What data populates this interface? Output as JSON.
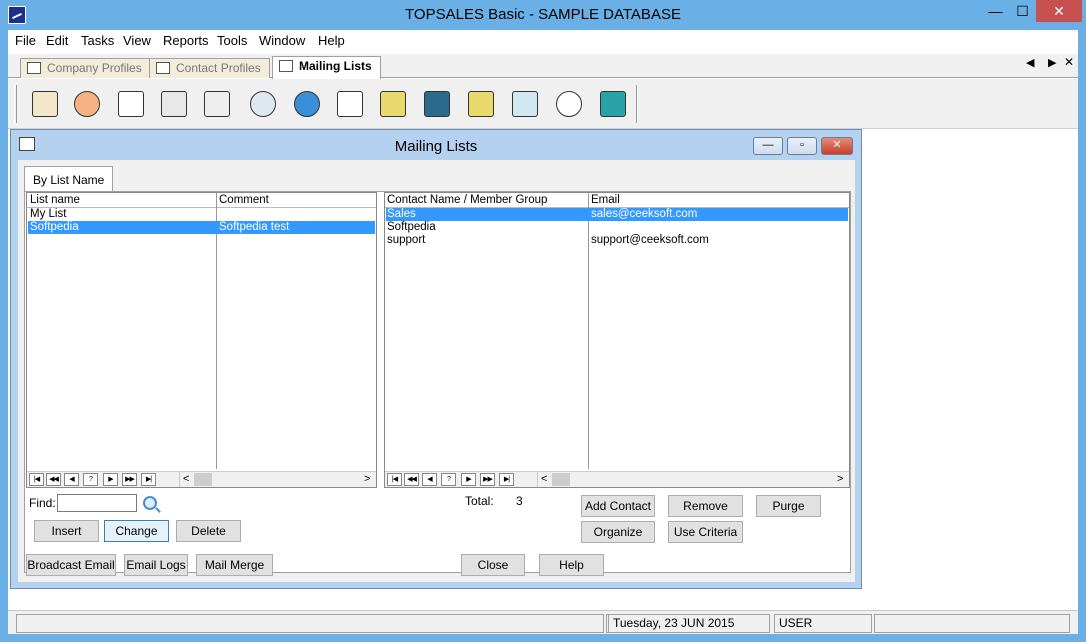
{
  "app": {
    "title": "TOPSALES Basic - SAMPLE DATABASE",
    "min_glyph": "—",
    "max_glyph": "☐",
    "close_glyph": "✕"
  },
  "menu": [
    "File",
    "Edit",
    "Tasks",
    "View",
    "Reports",
    "Tools",
    "Window",
    "Help"
  ],
  "doc_tabs": [
    {
      "label": "Company Profiles",
      "active": false
    },
    {
      "label": "Contact Profiles",
      "active": false
    },
    {
      "label": "Mailing Lists",
      "active": true
    }
  ],
  "doc_nav": {
    "prev": "◀",
    "next": "▶",
    "close": "✕"
  },
  "toolbar_icons": [
    "contact-home-icon",
    "people-icon",
    "envelope-icon",
    "address-card-icon",
    "calendar-icon",
    "magnifier-report-icon",
    "globe-computer-icon",
    "dollar-document-icon",
    "cash-register-icon",
    "bank-icon",
    "warehouse-icon",
    "desk-lamp-icon",
    "stopwatch-icon",
    "calculator-icon"
  ],
  "mdi": {
    "title": "Mailing Lists",
    "min_glyph": "—",
    "max_glyph": "▫",
    "close_glyph": "✕",
    "tab_label": "By List Name"
  },
  "lists_grid": {
    "columns": [
      "List name",
      "Comment"
    ],
    "rows": [
      {
        "name": "My List",
        "comment": "",
        "selected": false
      },
      {
        "name": "Softpedia",
        "comment": "Softpedia test",
        "selected": true
      }
    ]
  },
  "members_grid": {
    "columns": [
      "Contact Name / Member Group",
      "Email"
    ],
    "rows": [
      {
        "name": "Sales",
        "email": "sales@ceeksoft.com",
        "selected": true
      },
      {
        "name": "Softpedia",
        "email": "",
        "selected": false
      },
      {
        "name": "support",
        "email": "support@ceeksoft.com",
        "selected": false
      }
    ]
  },
  "grid_nav": [
    "|◀",
    "◀◀",
    "◀",
    "?",
    "▶",
    "▶▶",
    "▶|"
  ],
  "scroll": {
    "left": "<",
    "right": ">"
  },
  "find_label": "Find:",
  "find_value": "",
  "total_label": "Total:",
  "total_value": "3",
  "buttons": {
    "insert": "Insert",
    "change": "Change",
    "delete": "Delete",
    "add_contact": "Add Contact",
    "remove": "Remove",
    "purge": "Purge",
    "organize": "Organize",
    "use_criteria": "Use Criteria",
    "broadcast_email": "Broadcast Email",
    "email_logs": "Email Logs",
    "mail_merge": "Mail Merge",
    "close": "Close",
    "help": "Help"
  },
  "status": {
    "pane1": "",
    "pane2": "",
    "date": "Tuesday, 23 JUN 2015",
    "user": "USER",
    "pane5": ""
  }
}
